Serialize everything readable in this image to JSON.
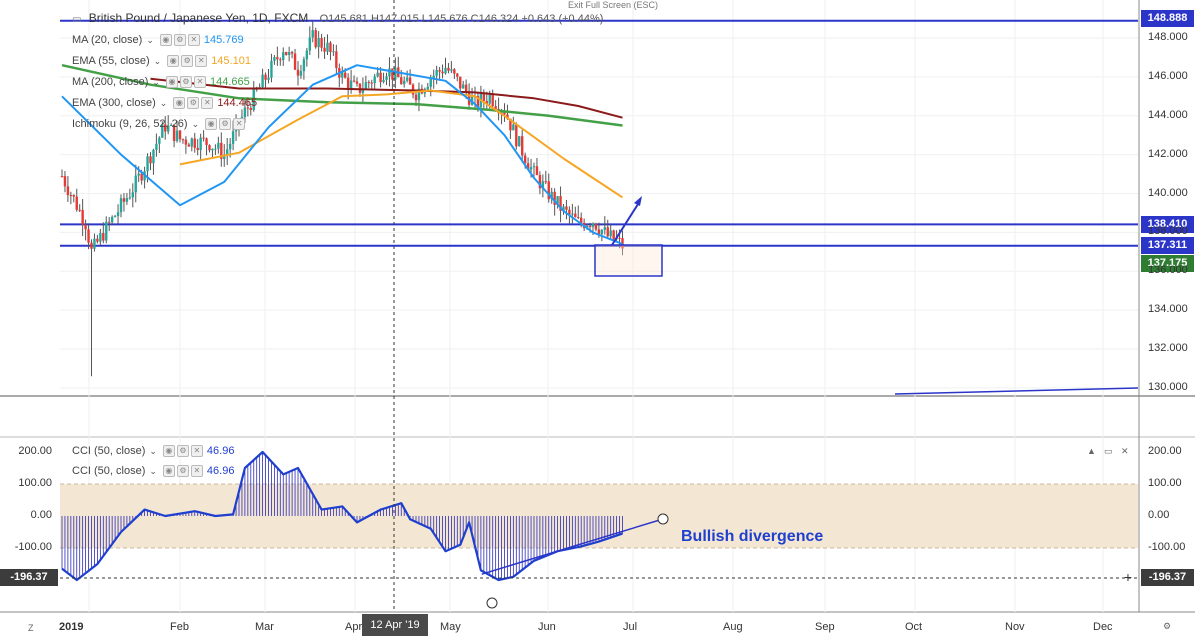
{
  "header": {
    "symbol": "British Pound / Japanese Yen, 1D, FXCM",
    "ohlc": "O145.681  H147.015  L145.676  C146.324  +0.643 (+0.44%)",
    "fullscreen_hint": "Exit Full Screen (ESC)"
  },
  "legend": [
    {
      "name": "MA (20, close)",
      "value": "145.769",
      "color": "#2196f3"
    },
    {
      "name": "EMA (55, close)",
      "value": "145.101",
      "color": "#f5a623"
    },
    {
      "name": "MA (200, close)",
      "value": "144.665",
      "color": "#43a047"
    },
    {
      "name": "EMA (300, close)",
      "value": "144.465",
      "color": "#8b1a1a"
    },
    {
      "name": "Ichimoku (9, 26, 52, 26)",
      "value": "",
      "color": "#9aa"
    }
  ],
  "cci_legend": [
    {
      "name": "CCI (50, close)",
      "value": "46.96",
      "color": "#1f3fcf"
    },
    {
      "name": "CCI (50, close)",
      "value": "46.96",
      "color": "#1f3fcf"
    }
  ],
  "price_axis": {
    "ticks": [
      "148.000",
      "146.000",
      "144.000",
      "142.000",
      "140.000",
      "138.000",
      "136.000",
      "134.000",
      "132.000",
      "130.000"
    ],
    "tick_values": [
      148,
      146,
      144,
      142,
      140,
      138,
      136,
      134,
      132,
      130
    ],
    "labels": {
      "top_line": "148.888",
      "upper_line": "138.410",
      "lower_line": "137.311",
      "last_price": "137.175"
    }
  },
  "cci_axis": {
    "ticks": [
      "200.00",
      "100.00",
      "0.00",
      "-100.00",
      "-200.00"
    ],
    "tick_values": [
      200,
      100,
      0,
      -100,
      -200
    ],
    "cursor_value": "-196.37"
  },
  "time_axis": {
    "labels": [
      "2019",
      "Feb",
      "Mar",
      "Apr",
      "May",
      "Jun",
      "Jul",
      "Aug",
      "Sep",
      "Oct",
      "Nov",
      "Dec"
    ],
    "cursor_date": "12 Apr '19"
  },
  "annotation": {
    "divergence_text": "Bullish divergence"
  },
  "colors": {
    "up": "#26a69a",
    "down": "#e53935",
    "hline": "#2b35c8",
    "last_price_bg": "#2e7d32",
    "cci_band": "#f3e6d3"
  },
  "chart_data": {
    "type": "candlestick",
    "price_ylim": [
      130,
      148.9
    ],
    "hlines": [
      148.888,
      138.41,
      137.311
    ],
    "ma20": [
      [
        0,
        145.0
      ],
      [
        20,
        142.0
      ],
      [
        40,
        139.4
      ],
      [
        55,
        140.6
      ],
      [
        70,
        143.4
      ],
      [
        85,
        145.6
      ],
      [
        100,
        146.6
      ],
      [
        115,
        146.2
      ],
      [
        130,
        145.8
      ],
      [
        140,
        144.6
      ],
      [
        150,
        143.0
      ],
      [
        160,
        140.8
      ],
      [
        170,
        139.1
      ],
      [
        180,
        138.0
      ],
      [
        190,
        137.4
      ]
    ],
    "ema55": [
      [
        40,
        141.5
      ],
      [
        60,
        142.1
      ],
      [
        80,
        143.8
      ],
      [
        95,
        145.0
      ],
      [
        110,
        145.1
      ],
      [
        125,
        145.3
      ],
      [
        140,
        145.0
      ],
      [
        150,
        144.0
      ],
      [
        160,
        142.9
      ],
      [
        170,
        141.8
      ],
      [
        180,
        140.8
      ],
      [
        190,
        139.8
      ]
    ],
    "ma200": [
      [
        0,
        146.6
      ],
      [
        30,
        145.6
      ],
      [
        60,
        144.9
      ],
      [
        90,
        144.7
      ],
      [
        120,
        144.6
      ],
      [
        145,
        144.3
      ],
      [
        165,
        144.0
      ],
      [
        190,
        143.5
      ]
    ],
    "ema300": [
      [
        30,
        145.9
      ],
      [
        60,
        145.4
      ],
      [
        90,
        145.4
      ],
      [
        120,
        145.3
      ],
      [
        140,
        145.2
      ],
      [
        160,
        144.9
      ],
      [
        175,
        144.5
      ],
      [
        190,
        143.9
      ]
    ],
    "cci_ylim": [
      -210,
      225
    ],
    "cci": [
      [
        0,
        -165
      ],
      [
        5,
        -200
      ],
      [
        12,
        -150
      ],
      [
        20,
        -50
      ],
      [
        28,
        20
      ],
      [
        35,
        0
      ],
      [
        45,
        15
      ],
      [
        52,
        0
      ],
      [
        58,
        5
      ],
      [
        62,
        150
      ],
      [
        68,
        200
      ],
      [
        75,
        130
      ],
      [
        80,
        150
      ],
      [
        88,
        20
      ],
      [
        95,
        30
      ],
      [
        100,
        -20
      ],
      [
        108,
        20
      ],
      [
        115,
        40
      ],
      [
        118,
        -10
      ],
      [
        125,
        -40
      ],
      [
        130,
        -110
      ],
      [
        135,
        -90
      ],
      [
        138,
        -20
      ],
      [
        142,
        -170
      ],
      [
        148,
        -200
      ],
      [
        153,
        -190
      ],
      [
        160,
        -140
      ],
      [
        168,
        -110
      ],
      [
        176,
        -95
      ],
      [
        182,
        -80
      ],
      [
        190,
        -55
      ]
    ],
    "divergence_line": [
      [
        145,
        -210
      ],
      [
        207,
        0
      ]
    ]
  }
}
